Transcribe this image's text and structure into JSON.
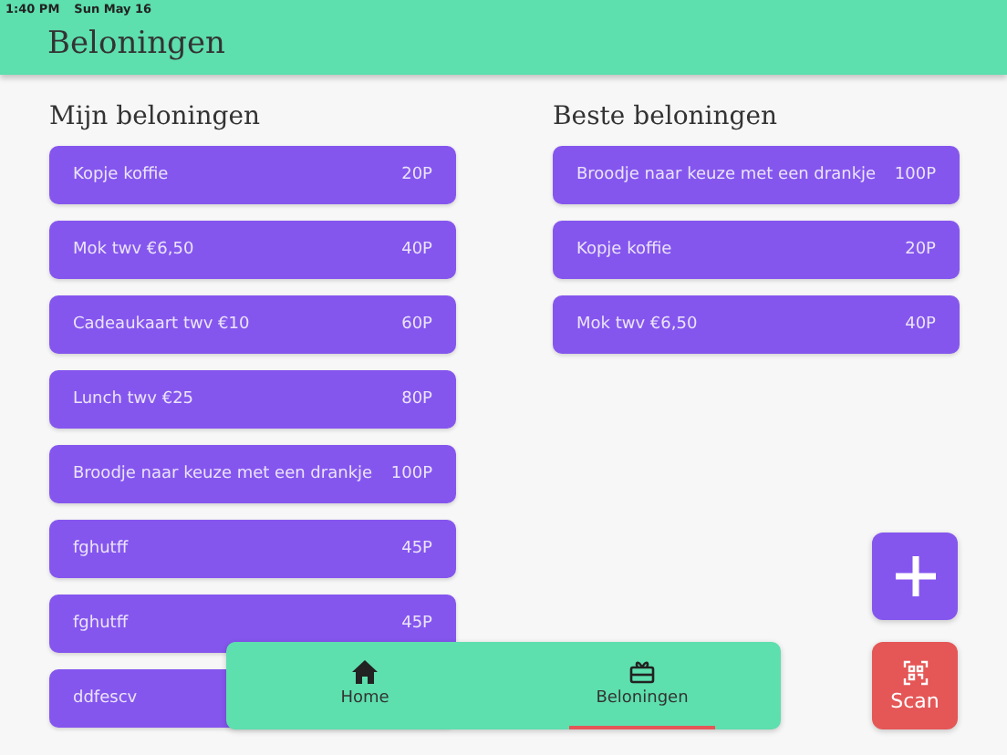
{
  "status_bar": {
    "time": "1:40 PM",
    "date": "Sun May 16"
  },
  "header": {
    "title": "Beloningen"
  },
  "my_rewards": {
    "title": "Mijn beloningen",
    "items": [
      {
        "name": "Kopje koffie",
        "points": "20P"
      },
      {
        "name": "Mok twv €6,50",
        "points": "40P"
      },
      {
        "name": "Cadeaukaart twv €10",
        "points": "60P"
      },
      {
        "name": "Lunch twv €25",
        "points": "80P"
      },
      {
        "name": "Broodje naar keuze met een drankje",
        "points": "100P"
      },
      {
        "name": "fghutff",
        "points": "45P"
      },
      {
        "name": "fghutff",
        "points": "45P"
      },
      {
        "name": "ddfescv"
      }
    ]
  },
  "best_rewards": {
    "title": "Beste beloningen",
    "items": [
      {
        "name": "Broodje naar keuze met een drankje",
        "points": "100P"
      },
      {
        "name": "Kopje koffie",
        "points": "20P"
      },
      {
        "name": "Mok twv €6,50",
        "points": "40P"
      }
    ]
  },
  "bottom_nav": [
    {
      "kind": "home",
      "label": "Home",
      "selected": false
    },
    {
      "kind": "rewards",
      "label": "Beloningen",
      "selected": true
    }
  ],
  "scan_button": {
    "label": "Scan"
  }
}
